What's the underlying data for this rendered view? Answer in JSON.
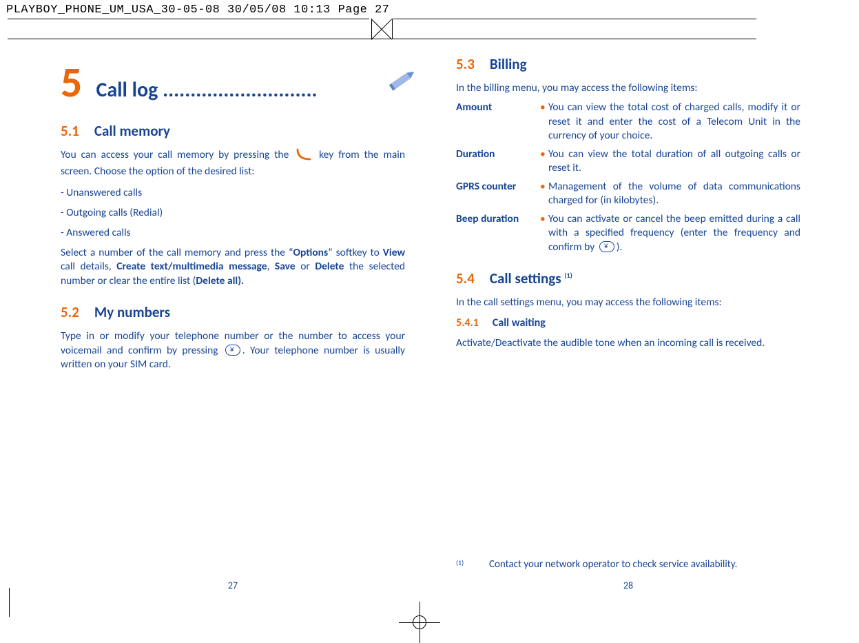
{
  "preflight": "PLAYBOY_PHONE_UM_USA_30-05-08  30/05/08  10:13  Page 27",
  "left": {
    "chapter_num": "5",
    "chapter_title": "Call log ............................",
    "s51_num": "5.1",
    "s51_title": "Call memory",
    "s51_p1a": "You can access your call memory by pressing the ",
    "s51_p1b": " key from the main screen. Choose the option of the desired list:",
    "s51_li1": "Unanswered calls",
    "s51_li2": "Outgoing calls (Redial)",
    "s51_li3": "Answered calls",
    "s51_p2_pre": "Select a number of the call memory and press the “",
    "s51_p2_options": "Options",
    "s51_p2_mid1": "” softkey to ",
    "s51_p2_view": "View",
    "s51_p2_mid2": " call details,  ",
    "s51_p2_create": "Create text/multimedia message",
    "s51_p2_mid3": ",  ",
    "s51_p2_save": "Save",
    "s51_p2_mid4": " or ",
    "s51_p2_delete": "Delete",
    "s51_p2_mid5": " the selected number or clear the entire list (",
    "s51_p2_deleteall": "Delete all).",
    "s52_num": "5.2",
    "s52_title": "My numbers",
    "s52_p1a": "Type in or modify your telephone number or the number to access your voicemail and confirm by pressing ",
    "s52_p1b": ".  Your telephone number is usually written on your SIM card.",
    "page_num": "27"
  },
  "right": {
    "s53_num": "5.3",
    "s53_title": "Billing",
    "s53_intro": "In the billing menu,  you may access the following items:",
    "defs": [
      {
        "term": "Amount",
        "desc": "You can view the total cost of charged calls, modify it or reset it and enter the cost of a Telecom Unit in the currency of your choice."
      },
      {
        "term": "Duration",
        "desc": "You can view the total duration of all outgoing calls or reset it."
      },
      {
        "term": "GPRS counter",
        "desc": "Management of the volume of data communications charged for (in kilobytes)."
      },
      {
        "term": "Beep duration",
        "desc_a": "You can activate or cancel the beep emitted during a call with a specified frequency (enter the frequency and confirm by ",
        "desc_b": ")."
      }
    ],
    "s54_num": "5.4",
    "s54_title": "Call settings ",
    "s54_sup": "(1)",
    "s54_intro": "In the call settings menu,  you may access the following items:",
    "s541_num": "5.4.1",
    "s541_title": "Call waiting",
    "s541_p": "Activate/Deactivate the audible tone when an incoming call is received.",
    "fn_mark": "(1)",
    "fn_text": "Contact your network operator to check service availability.",
    "page_num": "28"
  }
}
